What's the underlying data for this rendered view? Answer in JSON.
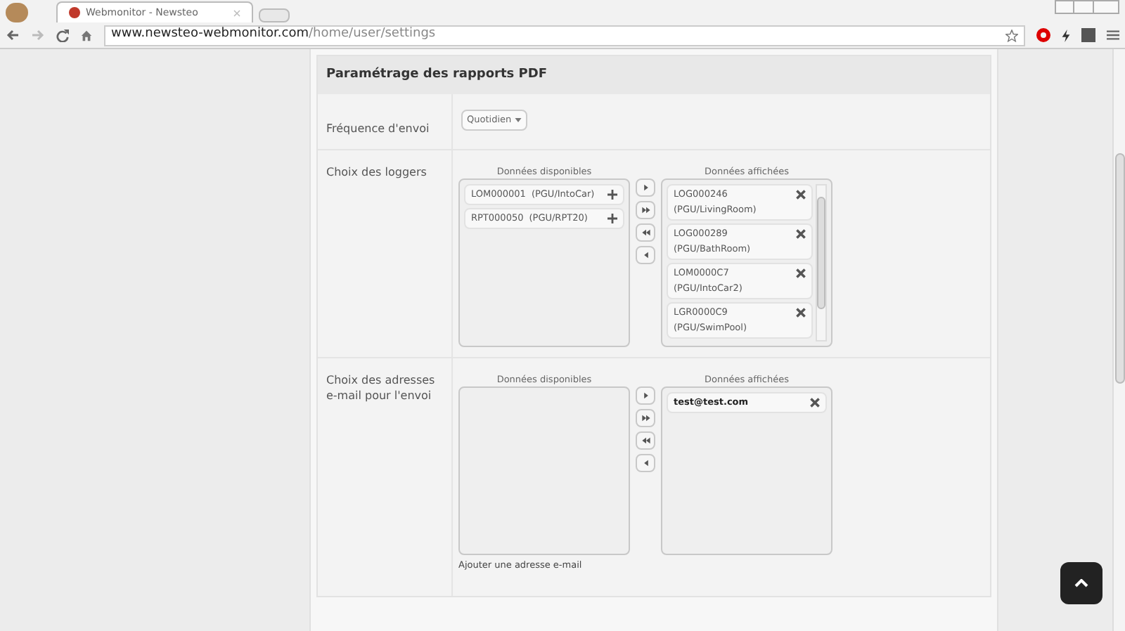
{
  "browser": {
    "tab_title": "Webmonitor - Newsteo",
    "url_host": "www.newsteo-webmonitor.com",
    "url_path": "/home/user/settings"
  },
  "panel": {
    "title": "Paramétrage des rapports PDF",
    "frequency": {
      "label": "Fréquence d'envoi",
      "value": "Quotidien"
    },
    "sections": [
      {
        "label": "Choix des loggers",
        "available_title": "Données disponibles",
        "displayed_title": "Données affichées",
        "available": [
          {
            "name": "LOM000001",
            "detail": "(PGU/IntoCar)"
          },
          {
            "name": "RPT000050",
            "detail": "(PGU/RPT20)"
          }
        ],
        "displayed": [
          {
            "name": "LOG000246",
            "detail": "(PGU/LivingRoom)"
          },
          {
            "name": "LOG000289",
            "detail": "(PGU/BathRoom)"
          },
          {
            "name": "LOM0000C7",
            "detail": "(PGU/IntoCar2)"
          },
          {
            "name": "LGR0000C9",
            "detail": "(PGU/SwimPool)"
          }
        ]
      },
      {
        "label": "Choix des adresses e-mail pour l'envoi",
        "available_title": "Données disponibles",
        "displayed_title": "Données affichées",
        "displayed": [
          {
            "name": "test@test.com"
          }
        ],
        "footer_link": "Ajouter une adresse e-mail"
      }
    ]
  }
}
